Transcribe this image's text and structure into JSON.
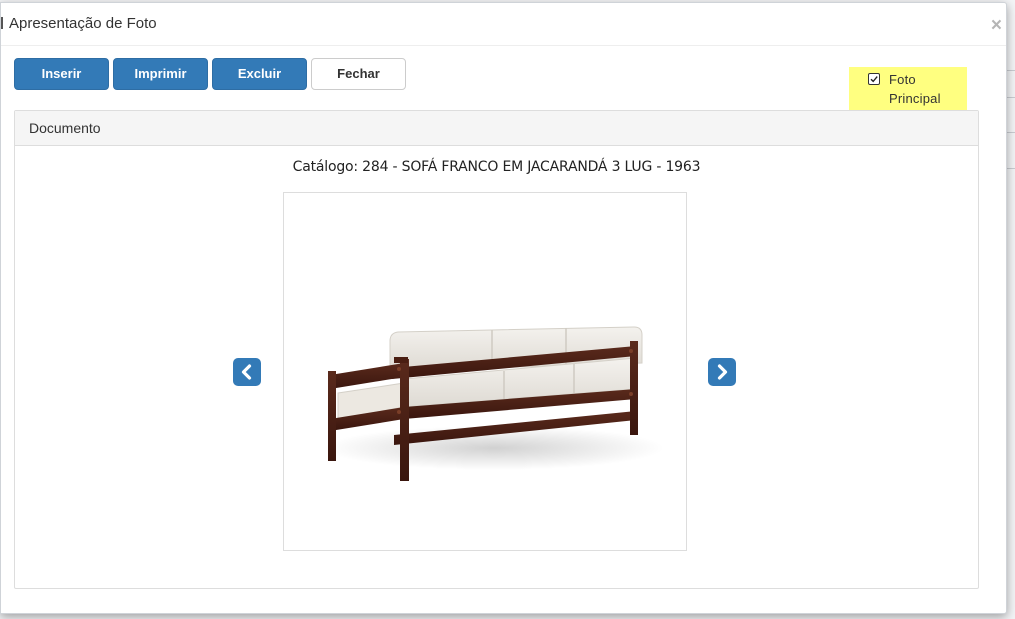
{
  "modal": {
    "title": "Apresentação de Foto",
    "close_label": "×"
  },
  "toolbar": {
    "inserir_label": "Inserir",
    "imprimir_label": "Imprimir",
    "excluir_label": "Excluir",
    "fechar_label": "Fechar"
  },
  "foto_principal": {
    "label": "Foto Principal",
    "checked": true,
    "highlight_color": "#ffff80"
  },
  "panel": {
    "title": "Documento"
  },
  "catalog": {
    "caption": "Catálogo: 284 - SOFÁ FRANCO EM JACARANDÁ 3 LUG - 1963"
  },
  "photo": {
    "subject": "sofa-image",
    "description_visible": false
  },
  "navigation": {
    "prev_icon": "chevron-left-icon",
    "next_icon": "chevron-right-icon"
  },
  "colors": {
    "primary": "#337ab7",
    "primary_border": "#2e6da4",
    "panel_heading_bg": "#f5f5f5"
  }
}
